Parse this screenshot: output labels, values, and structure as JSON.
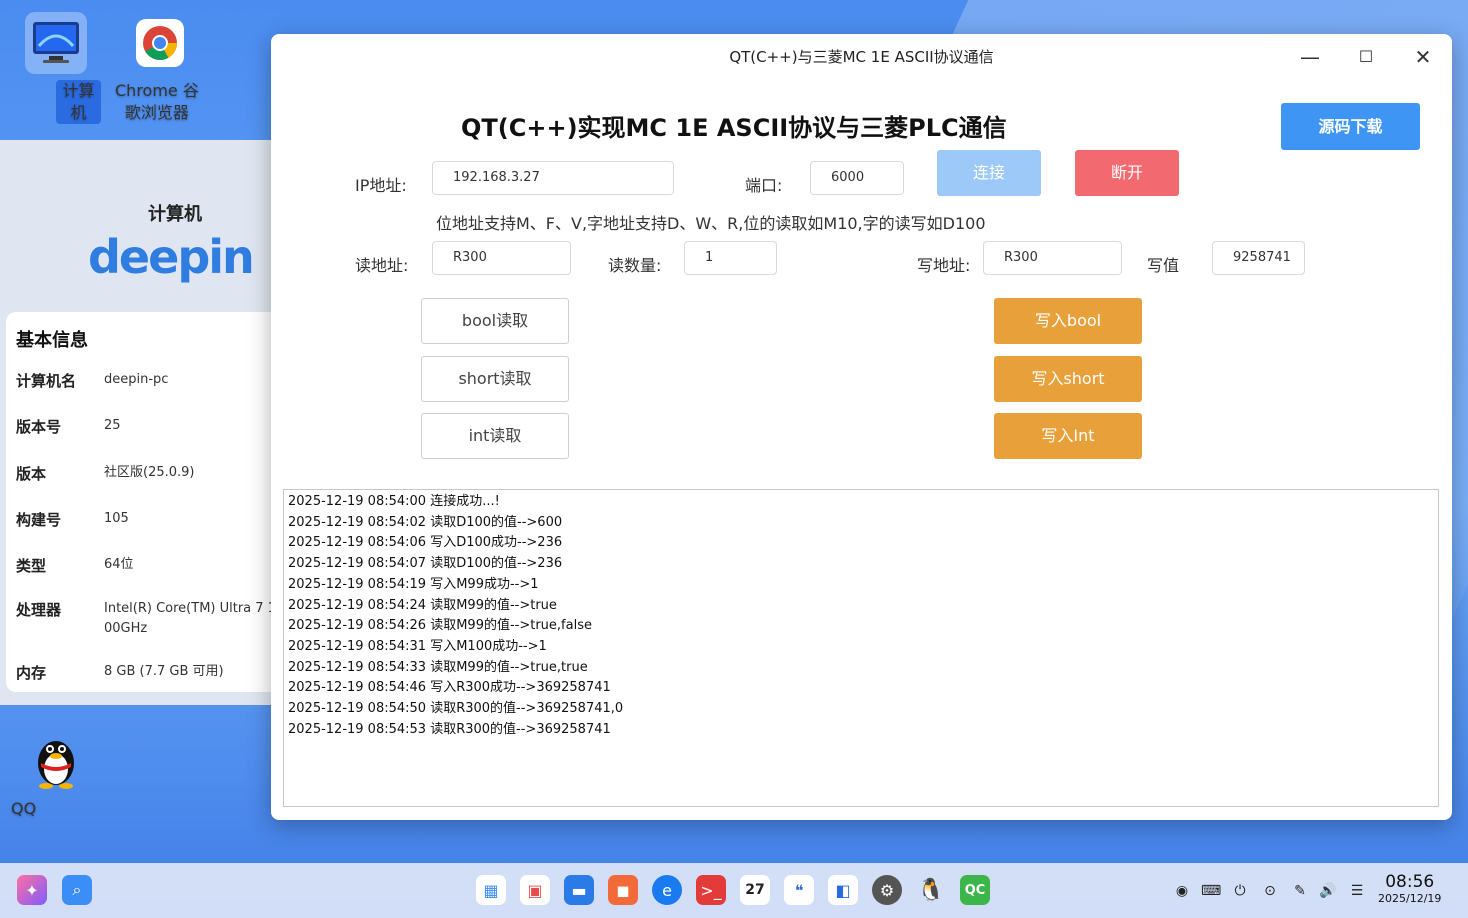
{
  "desktop": {
    "icons": [
      {
        "label": "计算机"
      },
      {
        "label": "Chrome 谷\n歌浏览器"
      },
      {
        "label": "QQ"
      }
    ]
  },
  "sysinfo": {
    "title": "计算机",
    "logo": "deepin",
    "section": "基本信息",
    "rows": [
      {
        "key": "计算机名",
        "value": "deepin-pc"
      },
      {
        "key": "版本号",
        "value": "25"
      },
      {
        "key": "版本",
        "value": "社区版(25.0.9)"
      },
      {
        "key": "构建号",
        "value": "105"
      },
      {
        "key": "类型",
        "value": "64位"
      },
      {
        "key": "处理器",
        "value": "Intel(R) Core(TM) Ultra 7 1\n00GHz"
      },
      {
        "key": "内存",
        "value": "8 GB (7.7 GB 可用)"
      }
    ]
  },
  "window": {
    "title": "QT(C++)与三菱MC 1E ASCII协议通信",
    "heading": "QT(C++)实现MC 1E ASCII协议与三菱PLC通信",
    "download_label": "源码下载",
    "ip_label": "IP地址:",
    "ip_value": "192.168.3.27",
    "port_label": "端口:",
    "port_value": "6000",
    "connect_label": "连接",
    "disconnect_label": "断开",
    "hint": "位地址支持M、F、V,字地址支持D、W、R,位的读取如M10,字的读写如D100",
    "read_addr_label": "读地址:",
    "read_addr_value": "R300",
    "read_count_label": "读数量:",
    "read_count_value": "1",
    "write_addr_label": "写地址:",
    "write_addr_value": "R300",
    "write_value_label": "写值",
    "write_value_value": "9258741",
    "read_bool": "bool读取",
    "read_short": "short读取",
    "read_int": "int读取",
    "write_bool": "写入bool",
    "write_short": "写入short",
    "write_int": "写入Int",
    "log": [
      "2025-12-19 08:54:00 连接成功...!",
      "2025-12-19 08:54:02 读取D100的值-->600",
      "2025-12-19 08:54:06 写入D100成功-->236",
      "2025-12-19 08:54:07 读取D100的值-->236",
      "2025-12-19 08:54:19 写入M99成功-->1",
      "2025-12-19 08:54:24 读取M99的值-->true",
      "2025-12-19 08:54:26 读取M99的值-->true,false",
      "2025-12-19 08:54:31 写入M100成功-->1",
      "2025-12-19 08:54:33 读取M99的值-->true,true",
      "2025-12-19 08:54:46 写入R300成功-->369258741",
      "2025-12-19 08:54:50 读取R300的值-->369258741,0",
      "2025-12-19 08:54:53 读取R300的值-->369258741"
    ]
  },
  "taskbar": {
    "calendar_day": "27",
    "clock_time": "08:56",
    "clock_date": "2025/12/19"
  },
  "colors": {
    "download": "#3e95f3",
    "connect": "#9dc9f8",
    "disconnect": "#f26a6f",
    "write": "#e8a03a"
  }
}
